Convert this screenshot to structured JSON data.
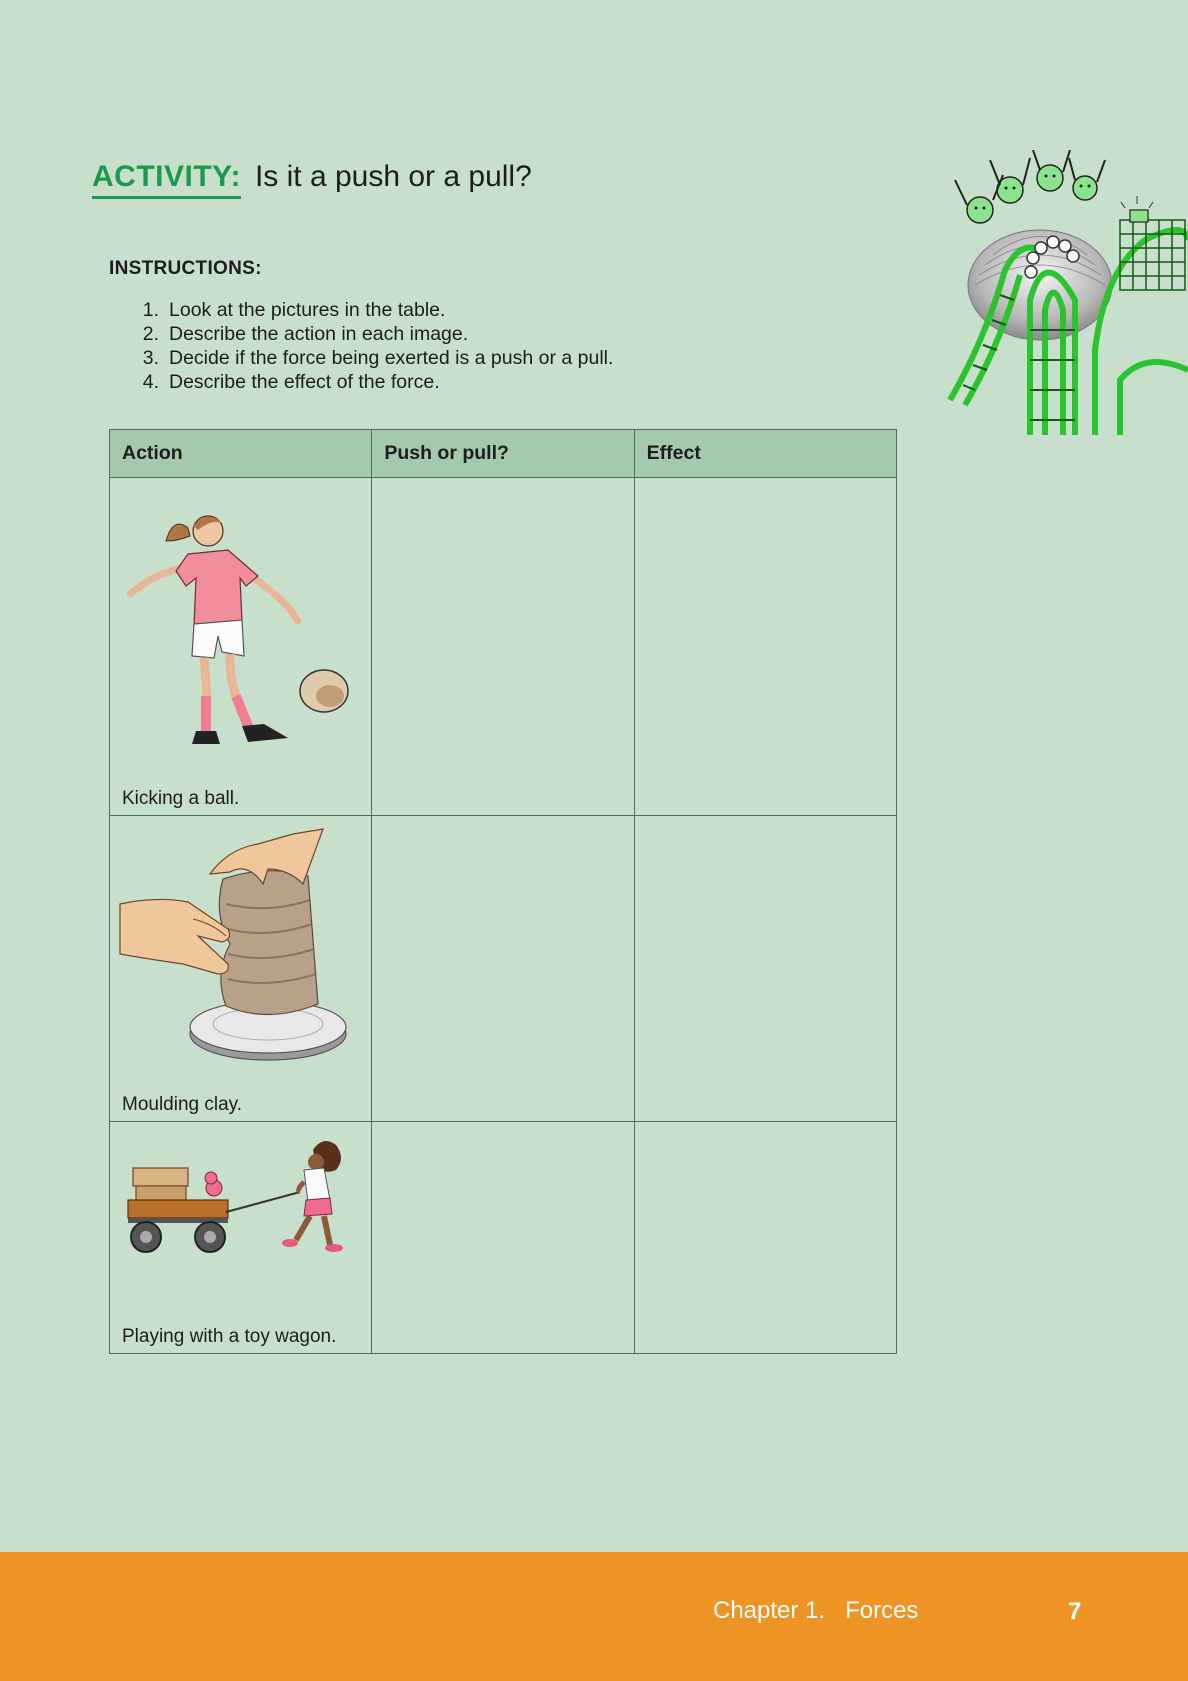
{
  "heading": {
    "label": "ACTIVITY:",
    "title": "Is it a push or a pull?"
  },
  "instructions": {
    "title": "INSTRUCTIONS:",
    "steps": [
      {
        "num": "1.",
        "text": "Look at the pictures in the table."
      },
      {
        "num": "2.",
        "text": "Describe the action in each image."
      },
      {
        "num": "3.",
        "text": "Decide if the force being exerted is a push or a pull."
      },
      {
        "num": "4.",
        "text": "Describe the effect of the force."
      }
    ]
  },
  "table": {
    "headers": [
      "Action",
      "Push or pull?",
      "Effect"
    ],
    "rows": [
      {
        "image": "girl-kicking-ball",
        "caption": "Kicking a ball.",
        "push_or_pull": "",
        "effect": ""
      },
      {
        "image": "hands-moulding-clay",
        "caption": "Moulding clay.",
        "push_or_pull": "",
        "effect": ""
      },
      {
        "image": "child-pulling-toy-wagon",
        "caption": "Playing with a toy wagon.",
        "push_or_pull": "",
        "effect": ""
      }
    ]
  },
  "footer": {
    "chapter_label": "Chapter 1.",
    "chapter_name": "Forces",
    "page_number": "7"
  },
  "colors": {
    "background": "#c8e0cb",
    "accent_green": "#1a9a4e",
    "table_header": "#a5c9ad",
    "footer_orange": "#ee9424"
  }
}
